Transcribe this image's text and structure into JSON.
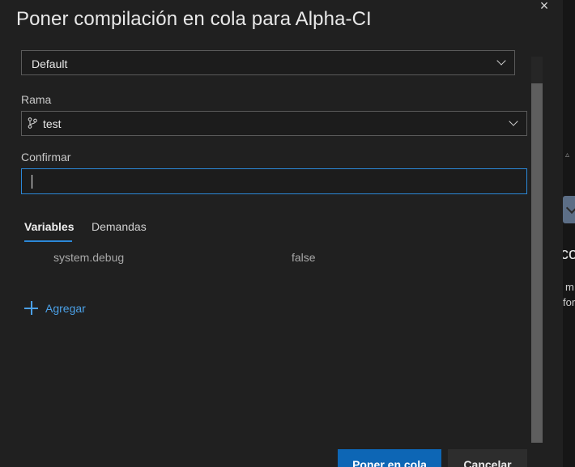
{
  "dialog": {
    "title": "Poner compilación en cola para Alpha-CI",
    "close_glyph": "×"
  },
  "pool": {
    "value": "Default"
  },
  "branch": {
    "label": "Rama",
    "value": "test"
  },
  "commit": {
    "label": "Confirmar",
    "value": ""
  },
  "tabs": [
    {
      "label": "Variables",
      "active": true
    },
    {
      "label": "Demandas",
      "active": false
    }
  ],
  "variables": [
    {
      "name": "system.debug",
      "value": "false"
    }
  ],
  "add_label": "Agregar",
  "buttons": {
    "queue": "Poner en cola",
    "cancel": "Cancelar"
  },
  "background": {
    "big": "co",
    "line1": "m",
    "line2": "for"
  },
  "colors": {
    "accent": "#2b88d8",
    "primary_button": "#0d66b5",
    "link": "#4ba0e6"
  }
}
